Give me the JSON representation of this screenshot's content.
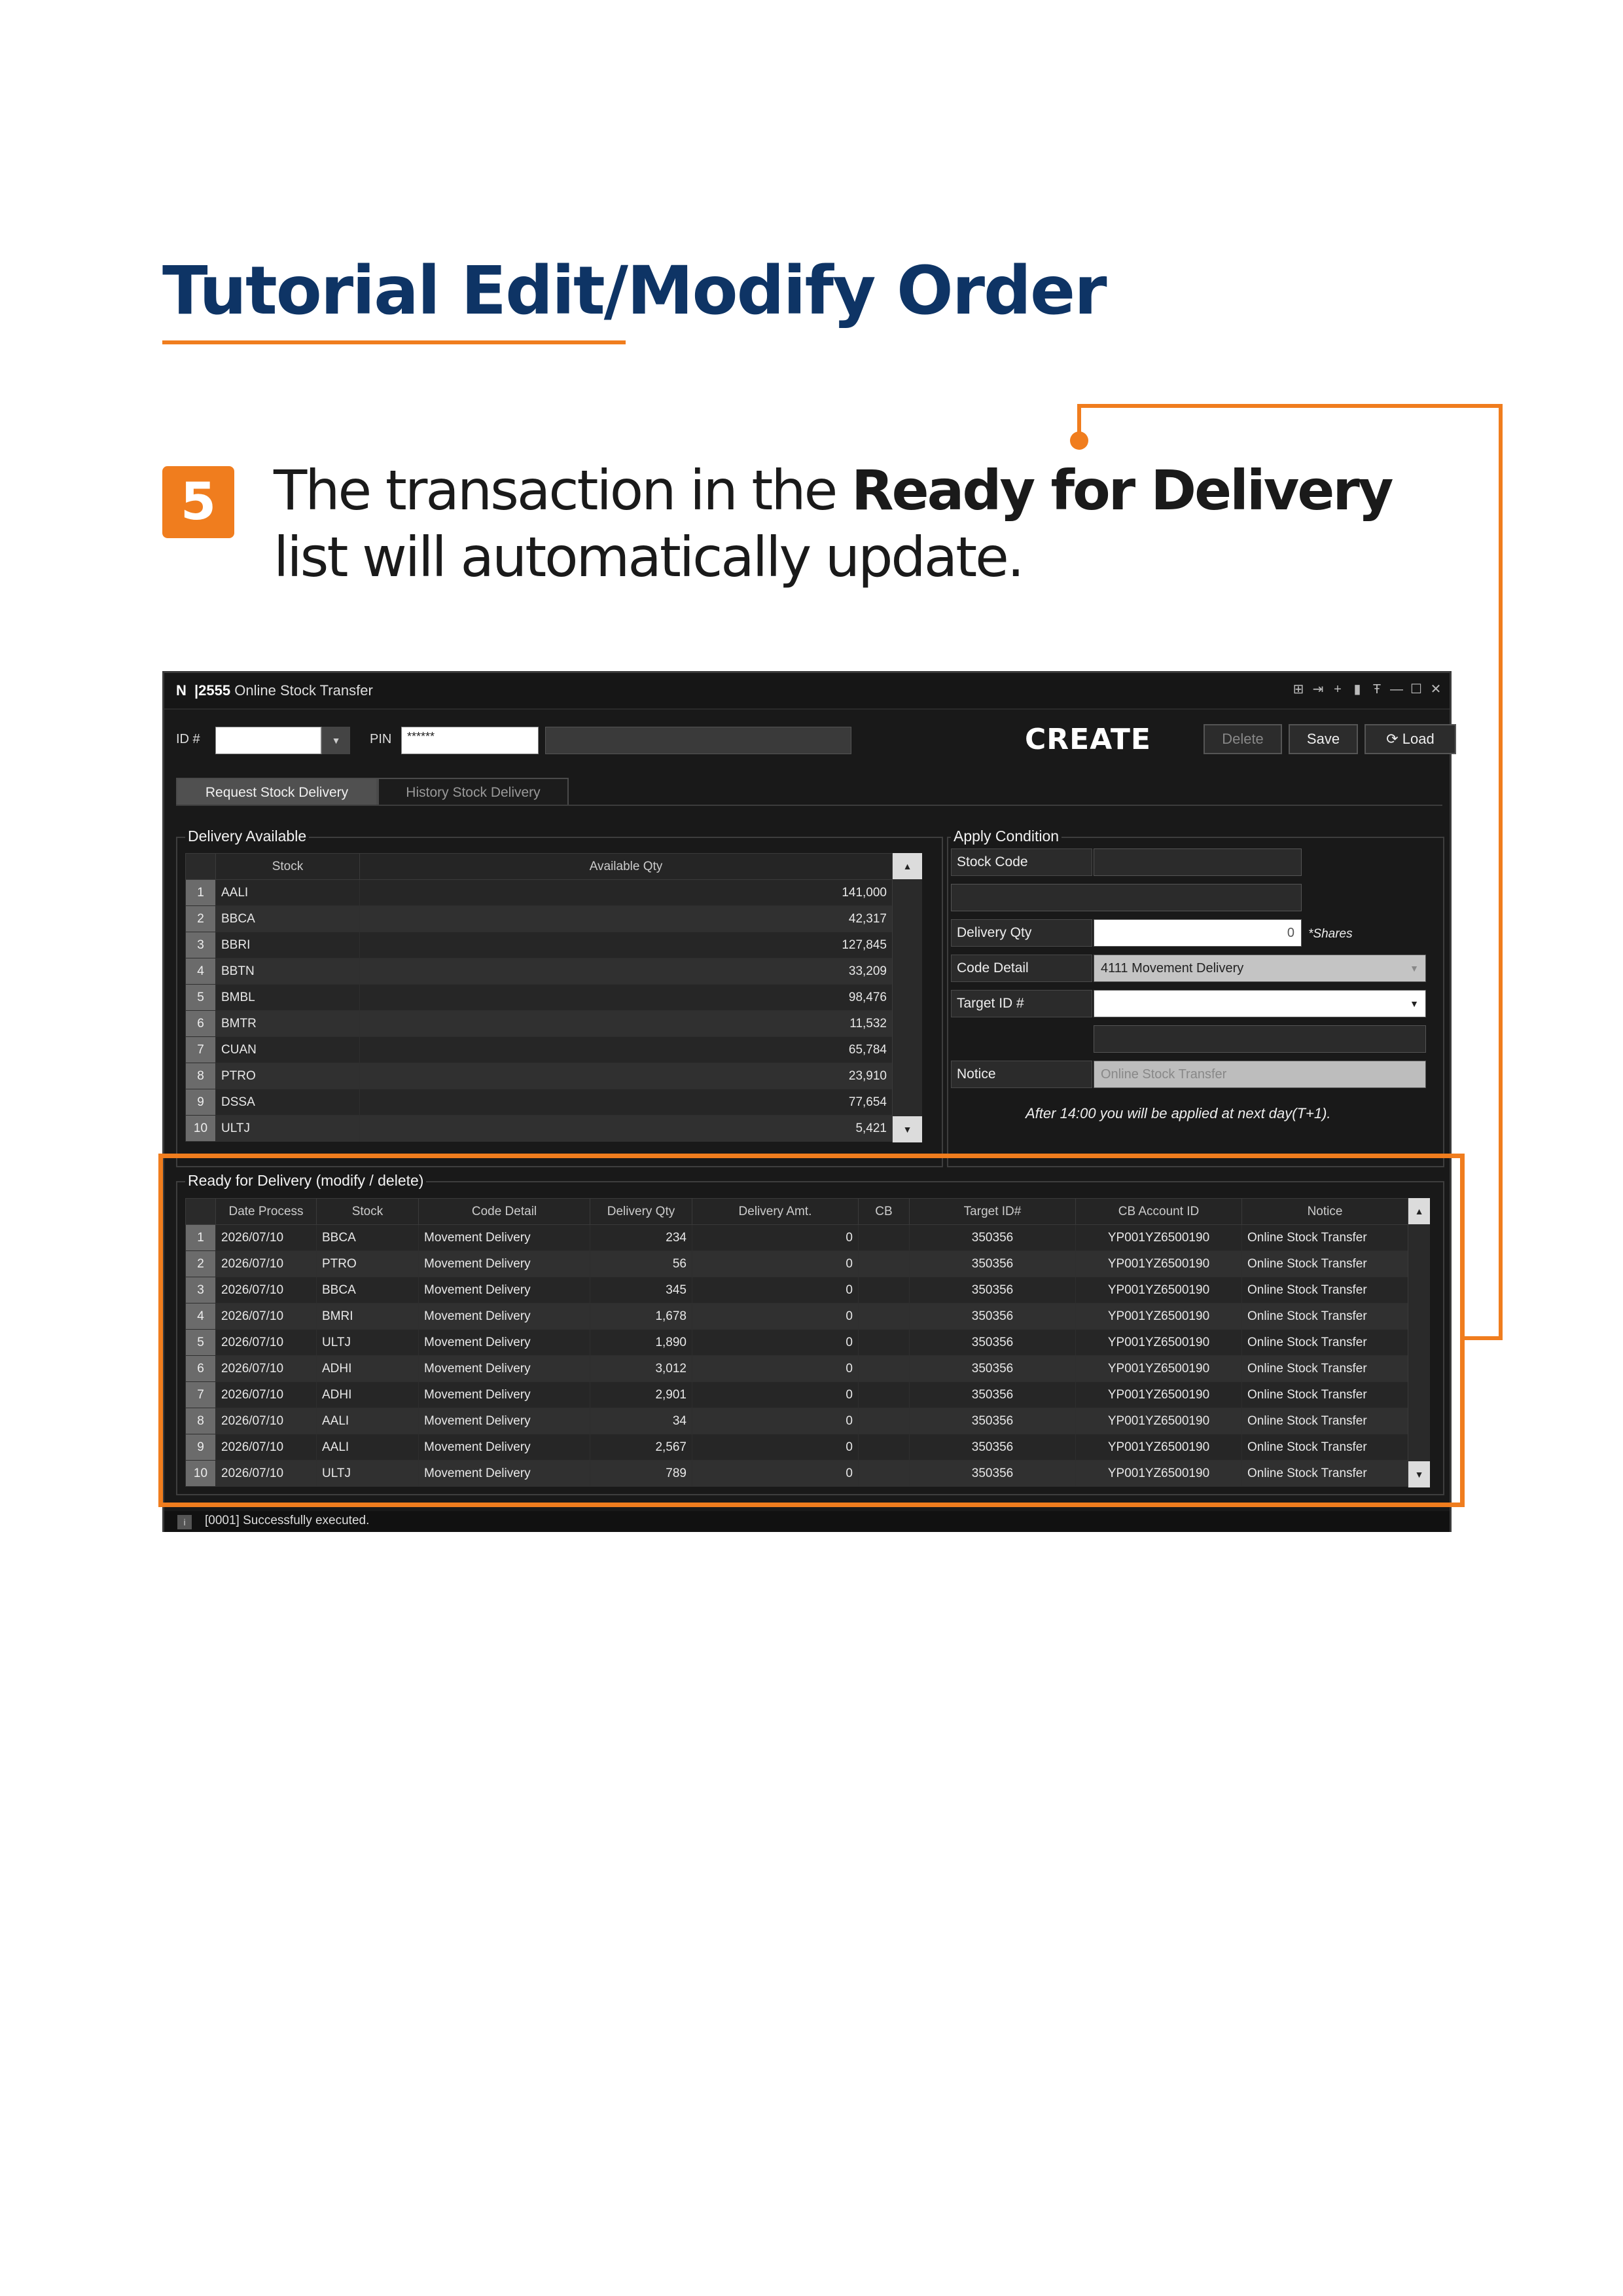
{
  "tutorial": {
    "title": "Tutorial Edit/Modify Order",
    "step_number": "5",
    "step_text_1": "The transaction in the ",
    "step_text_bold": "Ready for Delivery",
    "step_text_2": " list will automatically update."
  },
  "colors": {
    "accent": "#f07d1e",
    "title": "#0e3465",
    "window_bg": "#191919"
  },
  "window": {
    "logo": "N",
    "code": "|2555",
    "name": "Online Stock Transfer",
    "controls": [
      "grid-icon",
      "exit-icon",
      "plus-icon",
      "trash-icon",
      "font-size-icon",
      "minimize-icon",
      "maximize-icon",
      "close-icon"
    ]
  },
  "header": {
    "id_label": "ID #",
    "id_value": "",
    "pin_label": "PIN",
    "pin_value": "******",
    "mode": "CREATE",
    "buttons": {
      "delete": "Delete",
      "save": "Save",
      "load": "Load"
    }
  },
  "tabs": [
    {
      "label": "Request Stock Delivery",
      "active": true
    },
    {
      "label": "History Stock Delivery",
      "active": false
    }
  ],
  "delivery_available": {
    "title": "Delivery Available",
    "columns": [
      "Stock",
      "Available Qty"
    ],
    "rows": [
      {
        "no": "1",
        "stock": "AALI",
        "qty": "141,000"
      },
      {
        "no": "2",
        "stock": "BBCA",
        "qty": "42,317"
      },
      {
        "no": "3",
        "stock": "BBRI",
        "qty": "127,845"
      },
      {
        "no": "4",
        "stock": "BBTN",
        "qty": "33,209"
      },
      {
        "no": "5",
        "stock": "BMBL",
        "qty": "98,476"
      },
      {
        "no": "6",
        "stock": "BMTR",
        "qty": "11,532"
      },
      {
        "no": "7",
        "stock": "CUAN",
        "qty": "65,784"
      },
      {
        "no": "8",
        "stock": "PTRO",
        "qty": "23,910"
      },
      {
        "no": "9",
        "stock": "DSSA",
        "qty": "77,654"
      },
      {
        "no": "10",
        "stock": "ULTJ",
        "qty": "5,421"
      }
    ]
  },
  "apply_condition": {
    "title": "Apply Condition",
    "stock_code_label": "Stock Code",
    "stock_code_value": "",
    "delivery_qty_label": "Delivery Qty",
    "delivery_qty_value": "0",
    "shares_note": "*Shares",
    "code_detail_label": "Code Detail",
    "code_detail_value": "4111 Movement Delivery",
    "target_id_label": "Target ID #",
    "target_id_value": "",
    "notice_label": "Notice",
    "notice_placeholder": "Online Stock Transfer",
    "hint": "After 14:00 you will be applied at next day(T+1)."
  },
  "ready_for_delivery": {
    "title": "Ready for Delivery (modify / delete)",
    "columns": [
      "Date Process",
      "Stock",
      "Code Detail",
      "Delivery Qty",
      "Delivery Amt.",
      "CB",
      "Target ID#",
      "CB Account ID",
      "Notice"
    ],
    "rows": [
      {
        "no": "1",
        "date": "2026/07/10",
        "stock": "BBCA",
        "code": "Movement Delivery",
        "qty": "234",
        "amt": "0",
        "cb": "",
        "target": "350356",
        "account": "YP001YZ6500190",
        "notice": "Online Stock Transfer"
      },
      {
        "no": "2",
        "date": "2026/07/10",
        "stock": "PTRO",
        "code": "Movement Delivery",
        "qty": "56",
        "amt": "0",
        "cb": "",
        "target": "350356",
        "account": "YP001YZ6500190",
        "notice": "Online Stock Transfer"
      },
      {
        "no": "3",
        "date": "2026/07/10",
        "stock": "BBCA",
        "code": "Movement Delivery",
        "qty": "345",
        "amt": "0",
        "cb": "",
        "target": "350356",
        "account": "YP001YZ6500190",
        "notice": "Online Stock Transfer"
      },
      {
        "no": "4",
        "date": "2026/07/10",
        "stock": "BMRI",
        "code": "Movement Delivery",
        "qty": "1,678",
        "amt": "0",
        "cb": "",
        "target": "350356",
        "account": "YP001YZ6500190",
        "notice": "Online Stock Transfer"
      },
      {
        "no": "5",
        "date": "2026/07/10",
        "stock": "ULTJ",
        "code": "Movement Delivery",
        "qty": "1,890",
        "amt": "0",
        "cb": "",
        "target": "350356",
        "account": "YP001YZ6500190",
        "notice": "Online Stock Transfer"
      },
      {
        "no": "6",
        "date": "2026/07/10",
        "stock": "ADHI",
        "code": "Movement Delivery",
        "qty": "3,012",
        "amt": "0",
        "cb": "",
        "target": "350356",
        "account": "YP001YZ6500190",
        "notice": "Online Stock Transfer"
      },
      {
        "no": "7",
        "date": "2026/07/10",
        "stock": "ADHI",
        "code": "Movement Delivery",
        "qty": "2,901",
        "amt": "0",
        "cb": "",
        "target": "350356",
        "account": "YP001YZ6500190",
        "notice": "Online Stock Transfer"
      },
      {
        "no": "8",
        "date": "2026/07/10",
        "stock": "AALI",
        "code": "Movement Delivery",
        "qty": "34",
        "amt": "0",
        "cb": "",
        "target": "350356",
        "account": "YP001YZ6500190",
        "notice": "Online Stock Transfer"
      },
      {
        "no": "9",
        "date": "2026/07/10",
        "stock": "AALI",
        "code": "Movement Delivery",
        "qty": "2,567",
        "amt": "0",
        "cb": "",
        "target": "350356",
        "account": "YP001YZ6500190",
        "notice": "Online Stock Transfer"
      },
      {
        "no": "10",
        "date": "2026/07/10",
        "stock": "ULTJ",
        "code": "Movement Delivery",
        "qty": "789",
        "amt": "0",
        "cb": "",
        "target": "350356",
        "account": "YP001YZ6500190",
        "notice": "Online Stock Transfer"
      }
    ]
  },
  "status": {
    "icon": "i",
    "message": "[0001] Successfully executed."
  }
}
